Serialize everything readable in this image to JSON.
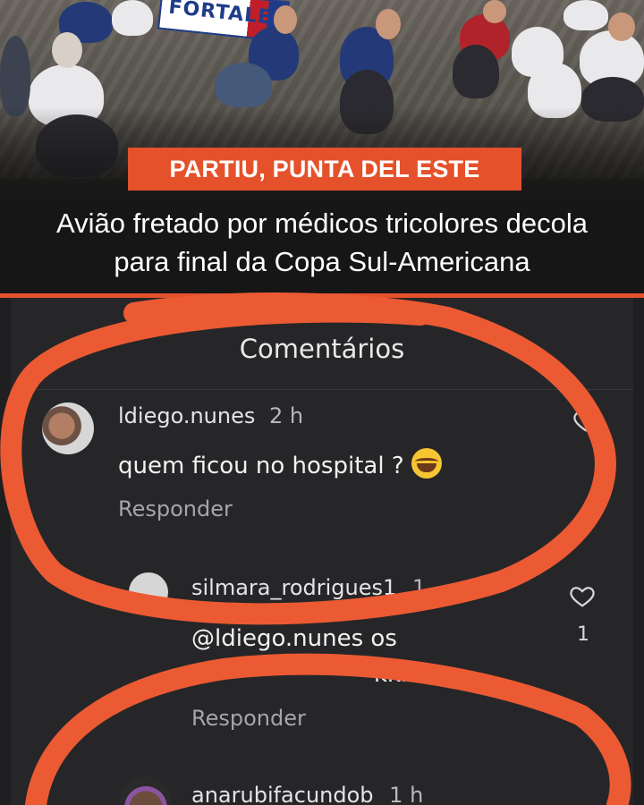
{
  "news": {
    "banner_text": "FORTALEZ",
    "tag": "PARTIU, PUNTA DEL ESTE",
    "headline_line1": "Avião fretado por médicos tricolores decola",
    "headline_line2": "para final da Copa Sul-Americana"
  },
  "comments_panel": {
    "title": "Comentários",
    "comments": [
      {
        "user": "ldiego.nunes",
        "time": "2 h",
        "text": "quem ficou no hospital ?",
        "emoji": "grinning-sweat-emoji",
        "reply_label": "Responder"
      },
      {
        "user": "silmara_rodrigues1",
        "time": "1",
        "text_line1": "@ldiego.nunes os",
        "text_line2": "kkkk",
        "likes": "1",
        "reply_label": "Responder"
      },
      {
        "user": "anarubifacundob",
        "time": "1 h"
      }
    ]
  },
  "colors": {
    "accent_orange": "#e5512a",
    "dark_bg": "#262628",
    "text_light": "#f2f2f3"
  }
}
